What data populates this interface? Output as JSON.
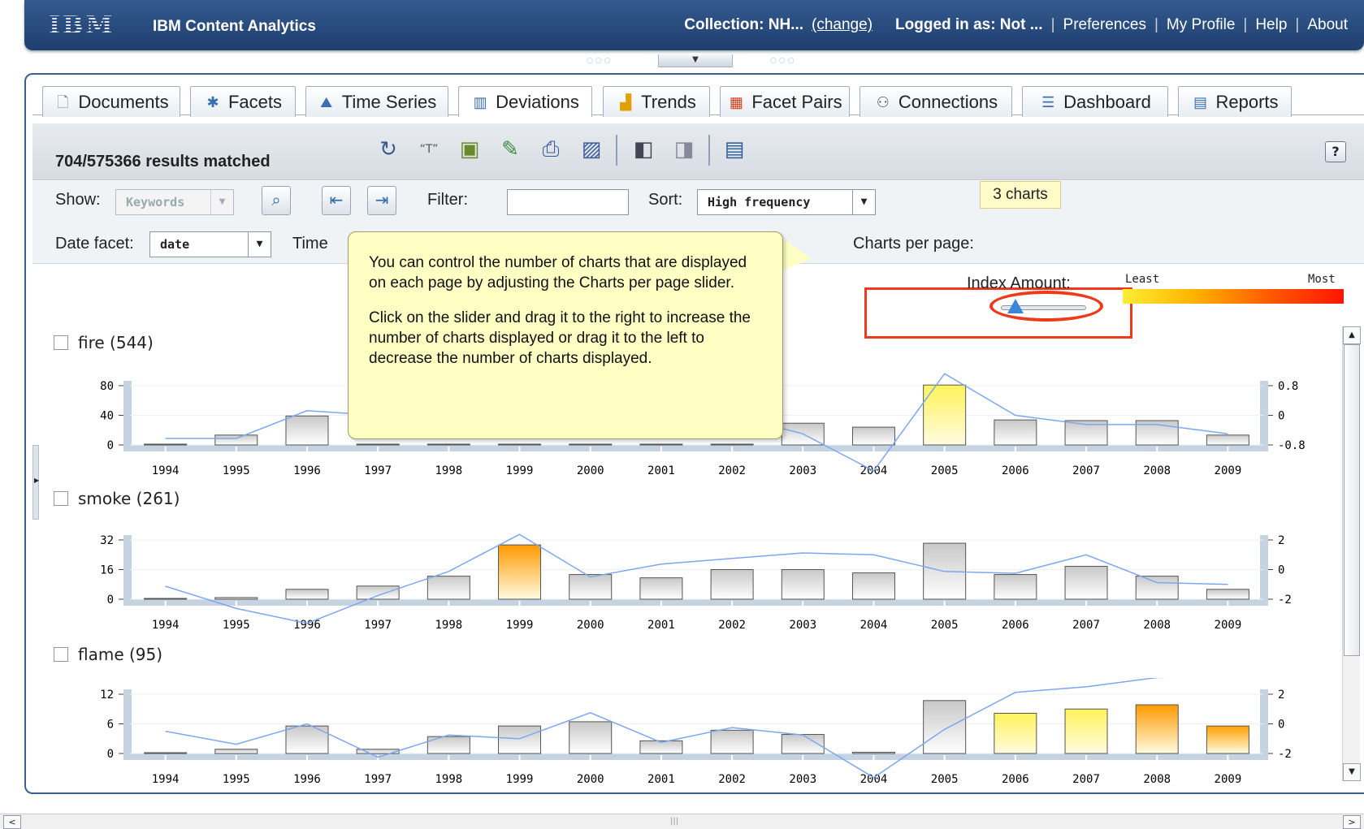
{
  "header": {
    "logo": "IBM",
    "app_title": "IBM Content Analytics",
    "collection": "Collection: NH...",
    "change_link": "(change)",
    "logged_in": "Logged in as: Not ...",
    "links": [
      "Preferences",
      "My Profile",
      "Help",
      "About"
    ]
  },
  "tabs": [
    {
      "label": "Documents",
      "icon": "document-icon"
    },
    {
      "label": "Facets",
      "icon": "facets-icon"
    },
    {
      "label": "Time Series",
      "icon": "time-series-icon"
    },
    {
      "label": "Deviations",
      "icon": "deviations-icon"
    },
    {
      "label": "Trends",
      "icon": "trends-icon"
    },
    {
      "label": "Facet Pairs",
      "icon": "facet-pairs-icon"
    },
    {
      "label": "Connections",
      "icon": "connections-icon"
    },
    {
      "label": "Dashboard",
      "icon": "dashboard-icon"
    },
    {
      "label": "Reports",
      "icon": "reports-icon"
    }
  ],
  "toolbar": {
    "results": "704/575366 results matched",
    "help": "?"
  },
  "controls": {
    "show_label": "Show:",
    "show_value": "Keywords",
    "filter_label": "Filter:",
    "filter_value": "",
    "sort_label": "Sort:",
    "sort_value": "High frequency",
    "date_facet_label": "Date facet:",
    "date_facet_value": "date",
    "time_label": "Time",
    "charts_per_page_label": "Charts per page:",
    "charts_tooltip": "3 charts"
  },
  "legend": {
    "label": "Index Amount:",
    "least": "Least",
    "most": "Most",
    "colors": [
      "#ffee33",
      "#ffb000",
      "#ff5a00",
      "#ff1500"
    ]
  },
  "callout": {
    "p1": "You can control the number of charts that are displayed on each page by adjusting the Charts per page slider.",
    "p2": "Click on the slider and drag it to the right to increase the number of charts displayed or drag it to the left to decrease the number of charts displayed."
  },
  "chart_data": [
    {
      "type": "bar",
      "title": "fire (544)",
      "categories": [
        "1994",
        "1995",
        "1996",
        "1997",
        "1998",
        "1999",
        "2000",
        "2001",
        "2002",
        "2003",
        "2004",
        "2005",
        "2006",
        "2007",
        "2008",
        "2009"
      ],
      "values": [
        1,
        15,
        44,
        0,
        0,
        0,
        0,
        0,
        0,
        33,
        27,
        91,
        38,
        37,
        37,
        15
      ],
      "index_line": [
        -0.5,
        -0.5,
        0.1,
        0,
        0,
        0,
        0,
        0,
        0,
        -0.4,
        -1.2,
        0.9,
        0.0,
        -0.2,
        -0.2,
        -0.4
      ],
      "highlight": {
        "2005": "#fff35a"
      },
      "ylim": [
        0,
        90
      ],
      "y_ticks": [
        "80",
        "40",
        "0"
      ],
      "y2_ticks": [
        "0.8",
        "0",
        "-0.8"
      ]
    },
    {
      "type": "bar",
      "title": "smoke (261)",
      "categories": [
        "1994",
        "1995",
        "1996",
        "1997",
        "1998",
        "1999",
        "2000",
        "2001",
        "2002",
        "2003",
        "2004",
        "2005",
        "2006",
        "2007",
        "2008",
        "2009"
      ],
      "values": [
        0,
        1,
        6,
        8,
        14,
        33,
        15,
        13,
        18,
        18,
        16,
        34,
        15,
        20,
        14,
        6
      ],
      "index_line": [
        -0.9,
        -2.1,
        -2.9,
        -1.4,
        -0.1,
        1.9,
        -0.4,
        0.3,
        0.6,
        0.9,
        0.8,
        -0.1,
        -0.2,
        0.8,
        -0.7,
        -0.8
      ],
      "highlight": {
        "1999": "#ff9a00"
      },
      "ylim": [
        0,
        36
      ],
      "y_ticks": [
        "32",
        "16",
        "0"
      ],
      "y2_ticks": [
        "2",
        "0",
        "-2"
      ]
    },
    {
      "type": "bar",
      "title": "flame (95)",
      "categories": [
        "1994",
        "1995",
        "1996",
        "1997",
        "1998",
        "1999",
        "2000",
        "2001",
        "2002",
        "2003",
        "2004",
        "2005",
        "2006",
        "2007",
        "2008",
        "2009"
      ],
      "values": [
        0,
        1,
        6.5,
        1,
        4,
        6.5,
        7.5,
        3,
        5.5,
        4.5,
        0.3,
        12.5,
        9.5,
        10.5,
        11.5,
        6.5
      ],
      "index_line": [
        -0.4,
        -1.1,
        0.0,
        -1.8,
        -0.6,
        -0.8,
        0.6,
        -1.0,
        -0.2,
        -0.6,
        -2.9,
        -0.3,
        1.7,
        2.0,
        2.5,
        2.6
      ],
      "highlight": {
        "2006": "#fff35a",
        "2007": "#fff35a",
        "2008": "#ff9a00",
        "2009": "#ffa000"
      },
      "ylim": [
        0,
        14
      ],
      "y_ticks": [
        "12",
        "6",
        "0"
      ],
      "y2_ticks": [
        "2",
        "0",
        "-2"
      ]
    }
  ]
}
